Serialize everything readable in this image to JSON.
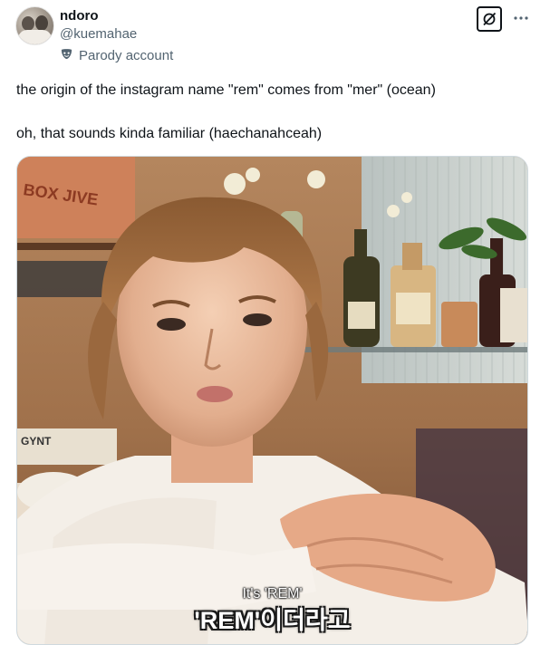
{
  "author": {
    "display_name": "ndoro",
    "handle": "@kuemahae",
    "label": "Parody account"
  },
  "icons": {
    "label_icon": "mask-icon",
    "grok_icon": "grok-icon",
    "more_icon": "more-icon"
  },
  "tweet": {
    "line1": "the origin of the instagram name \"rem\" comes from \"mer\" (ocean)",
    "line2": "oh, that sounds kinda familiar (haechanahceah)"
  },
  "media": {
    "subtitle_en": "It's 'REM'",
    "subtitle_ko": "'REM'이더라고",
    "sign_text_1": "BOX JIVE",
    "sign_text_2": "GYNT"
  },
  "colors": {
    "text_primary": "#0f1419",
    "text_secondary": "#536471",
    "border": "#cfd9de"
  }
}
